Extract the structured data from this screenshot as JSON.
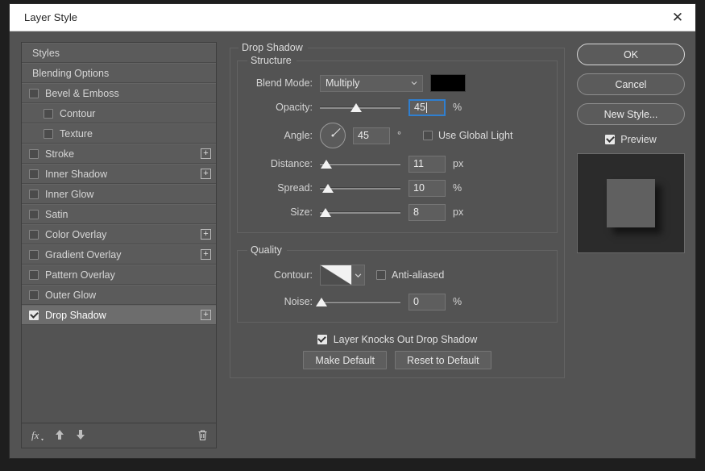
{
  "window": {
    "title": "Layer Style",
    "close_icon": "close-icon"
  },
  "sidebar": {
    "items": [
      {
        "label": "Styles",
        "checkbox": null,
        "indent": false,
        "plus": false,
        "selected": false
      },
      {
        "label": "Blending Options",
        "checkbox": null,
        "indent": false,
        "plus": false,
        "selected": false
      },
      {
        "label": "Bevel & Emboss",
        "checkbox": false,
        "indent": false,
        "plus": false,
        "selected": false
      },
      {
        "label": "Contour",
        "checkbox": false,
        "indent": true,
        "plus": false,
        "selected": false
      },
      {
        "label": "Texture",
        "checkbox": false,
        "indent": true,
        "plus": false,
        "selected": false
      },
      {
        "label": "Stroke",
        "checkbox": false,
        "indent": false,
        "plus": true,
        "selected": false
      },
      {
        "label": "Inner Shadow",
        "checkbox": false,
        "indent": false,
        "plus": true,
        "selected": false
      },
      {
        "label": "Inner Glow",
        "checkbox": false,
        "indent": false,
        "plus": false,
        "selected": false
      },
      {
        "label": "Satin",
        "checkbox": false,
        "indent": false,
        "plus": false,
        "selected": false
      },
      {
        "label": "Color Overlay",
        "checkbox": false,
        "indent": false,
        "plus": true,
        "selected": false
      },
      {
        "label": "Gradient Overlay",
        "checkbox": false,
        "indent": false,
        "plus": true,
        "selected": false
      },
      {
        "label": "Pattern Overlay",
        "checkbox": false,
        "indent": false,
        "plus": false,
        "selected": false
      },
      {
        "label": "Outer Glow",
        "checkbox": false,
        "indent": false,
        "plus": false,
        "selected": false
      },
      {
        "label": "Drop Shadow",
        "checkbox": true,
        "indent": false,
        "plus": true,
        "selected": true
      }
    ],
    "plus_label": "+",
    "footer": {
      "fx_icon": "fx",
      "up_icon": "⬆",
      "down_icon": "⬇",
      "trash_icon": "🗑"
    }
  },
  "panel": {
    "title": "Drop Shadow",
    "structure": {
      "legend": "Structure",
      "blend_mode": {
        "label": "Blend Mode:",
        "value": "Multiply",
        "color": "#000000"
      },
      "opacity": {
        "label": "Opacity:",
        "value": "45",
        "unit": "%",
        "slider_percent": 45,
        "focused": true
      },
      "angle": {
        "label": "Angle:",
        "value": "45",
        "unit": "°",
        "degrees": 45,
        "use_global_light": {
          "label": "Use Global Light",
          "checked": false
        }
      },
      "distance": {
        "label": "Distance:",
        "value": "11",
        "unit": "px",
        "slider_percent": 8
      },
      "spread": {
        "label": "Spread:",
        "value": "10",
        "unit": "%",
        "slider_percent": 10
      },
      "size": {
        "label": "Size:",
        "value": "8",
        "unit": "px",
        "slider_percent": 7
      }
    },
    "quality": {
      "legend": "Quality",
      "contour": {
        "label": "Contour:",
        "anti_aliased": {
          "label": "Anti-aliased",
          "checked": false
        }
      },
      "noise": {
        "label": "Noise:",
        "value": "0",
        "unit": "%",
        "slider_percent": 2
      }
    },
    "knockout": {
      "label": "Layer Knocks Out Drop Shadow",
      "checked": true
    },
    "make_default": "Make Default",
    "reset_to_default": "Reset to Default"
  },
  "actions": {
    "ok": "OK",
    "cancel": "Cancel",
    "new_style": "New Style...",
    "preview": {
      "label": "Preview",
      "checked": true
    }
  },
  "colors": {
    "dialog_bg": "#535353",
    "row_bg": "#5b5b5b",
    "row_selected": "#6d6d6d",
    "focus_blue": "#2f7fd0",
    "swatch": "#000000",
    "preview_bg": "#2b2b2b",
    "preview_square": "#606060"
  }
}
